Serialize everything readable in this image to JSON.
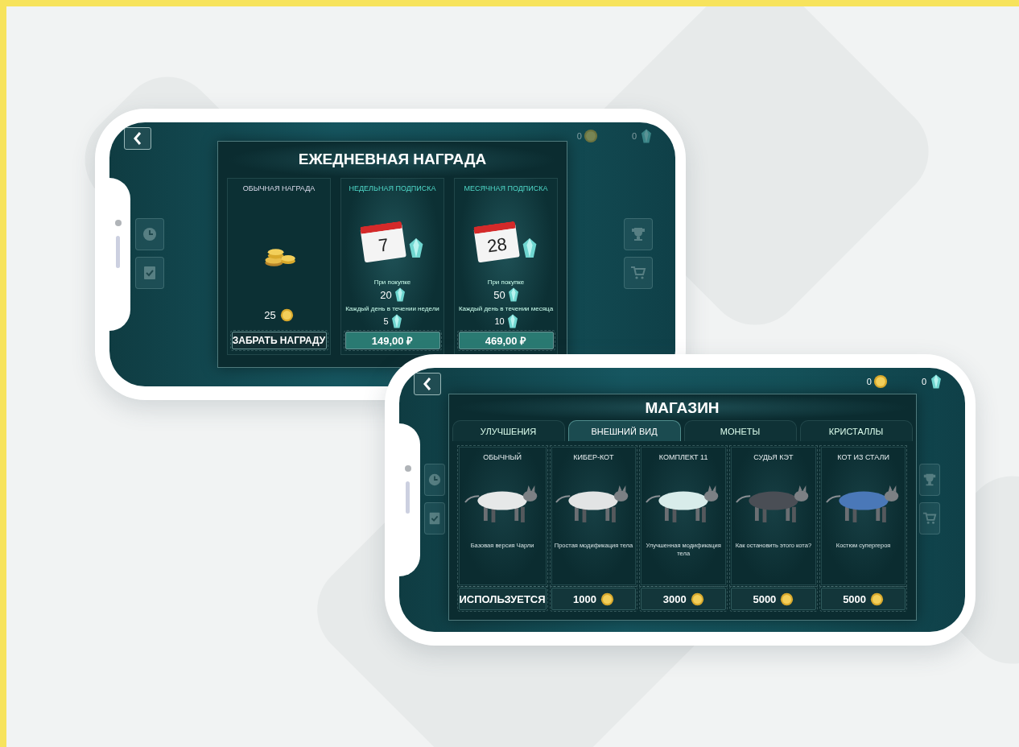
{
  "daily_reward": {
    "title": "ЕЖЕДНЕВНАЯ НАГРАДА",
    "coins": "0",
    "crystals": "0",
    "cards": [
      {
        "kind": "basic",
        "title": "ОБЫЧНАЯ НАГРАДА",
        "amount": "25",
        "button": "ЗАБРАТЬ НАГРАДУ"
      },
      {
        "kind": "subscription",
        "title": "НЕДЕЛЬНАЯ ПОДПИСКА",
        "calendar_day": "7",
        "purchase_label": "При покупке",
        "purchase_amount": "20",
        "daily_label": "Каждый день в течении недели",
        "daily_amount": "5",
        "button": "149,00 ₽"
      },
      {
        "kind": "subscription",
        "title": "МЕСЯЧНАЯ ПОДПИСКА",
        "calendar_day": "28",
        "purchase_label": "При покупке",
        "purchase_amount": "50",
        "daily_label": "Каждый день в течении месяца",
        "daily_amount": "10",
        "button": "469,00 ₽"
      }
    ]
  },
  "shop": {
    "title": "МАГАЗИН",
    "coins": "0",
    "crystals": "0",
    "tabs": [
      {
        "label": "УЛУЧШЕНИЯ",
        "selected": false
      },
      {
        "label": "ВНЕШНИЙ ВИД",
        "selected": true
      },
      {
        "label": "МОНЕТЫ",
        "selected": false
      },
      {
        "label": "КРИСТАЛЛЫ",
        "selected": false
      }
    ],
    "items": [
      {
        "name": "ОБЫЧНЫЙ",
        "description": "Базовая версия Чарли",
        "color": "#e6e8e8",
        "price": {
          "kind": "status",
          "text": "ИСПОЛЬЗУЕТСЯ"
        }
      },
      {
        "name": "КИБЕР-КОТ",
        "description": "Простая модификация тела",
        "color": "#e2e4e4",
        "price": {
          "kind": "coins",
          "text": "1000"
        }
      },
      {
        "name": "КОМПЛЕКТ 11",
        "description": "Улучшенная модификация тела",
        "color": "#d8ecea",
        "price": {
          "kind": "coins",
          "text": "3000"
        }
      },
      {
        "name": "СУДЬЯ КЭТ",
        "description": "Как остановить этого кота?",
        "color": "#4a4e55",
        "price": {
          "kind": "coins",
          "text": "5000"
        }
      },
      {
        "name": "КОТ ИЗ СТАЛИ",
        "description": "Костюм супергероя",
        "color": "#4a78b8",
        "price": {
          "kind": "coins",
          "text": "5000"
        }
      }
    ]
  }
}
